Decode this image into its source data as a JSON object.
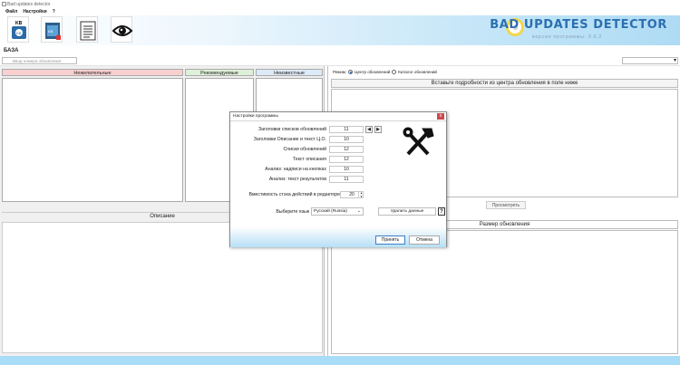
{
  "app": {
    "title": "Bad updates detector"
  },
  "menu": [
    "Файл",
    "Настройки",
    "?"
  ],
  "toolbar": {
    "tools": [
      "kb-icon",
      "db-icon",
      "document-icon",
      "eye-icon"
    ]
  },
  "logo": {
    "title": "BAD UPDATES DETECTOR",
    "version": "версия программы: 0.9.2"
  },
  "section": {
    "title": "БАЗА"
  },
  "search": {
    "placeholder": "Ввод номера обновления"
  },
  "left": {
    "columns": [
      "Нежелательные",
      "Рекомендуемые",
      "Неизвестные"
    ],
    "desc_header": "Описание"
  },
  "right": {
    "mode_label": "Режим:",
    "mode_options": [
      "Центр обновлений",
      "Каталог обновлений"
    ],
    "paste_header": "Вставьте подробности из центра обновления в поле ниже",
    "preview_btn": "Просмотреть",
    "size_header": "Размер обновления"
  },
  "colors": {
    "unwanted": "#f9d0d0",
    "recommended": "#dff0d8",
    "unknown": "#ddeaf7",
    "accent": "#2b6fb0"
  },
  "dialog": {
    "title": "Настройки программы",
    "rows": [
      {
        "label": "Заголовки списков обновлений",
        "value": "11"
      },
      {
        "label": "Заголовки Описание и текст Ц.О.",
        "value": "10"
      },
      {
        "label": "Списки обновлений",
        "value": "12"
      },
      {
        "label": "Текст описания",
        "value": "12"
      },
      {
        "label": "Анализ: надписи на кнопках",
        "value": "10"
      },
      {
        "label": "Анализ: текст результатов",
        "value": "11"
      }
    ],
    "stack_label": "Вместимость стэка действий в редакторе",
    "stack_value": "20",
    "lang_label": "Выберите язык",
    "lang_value": "Русский (Russia)",
    "delete_btn": "Удалить данные",
    "help": "?",
    "ok": "Принять",
    "cancel": "Отмена",
    "close": "x",
    "prev": "◀",
    "next": "▶",
    "tools_icon": "tools-icon"
  }
}
